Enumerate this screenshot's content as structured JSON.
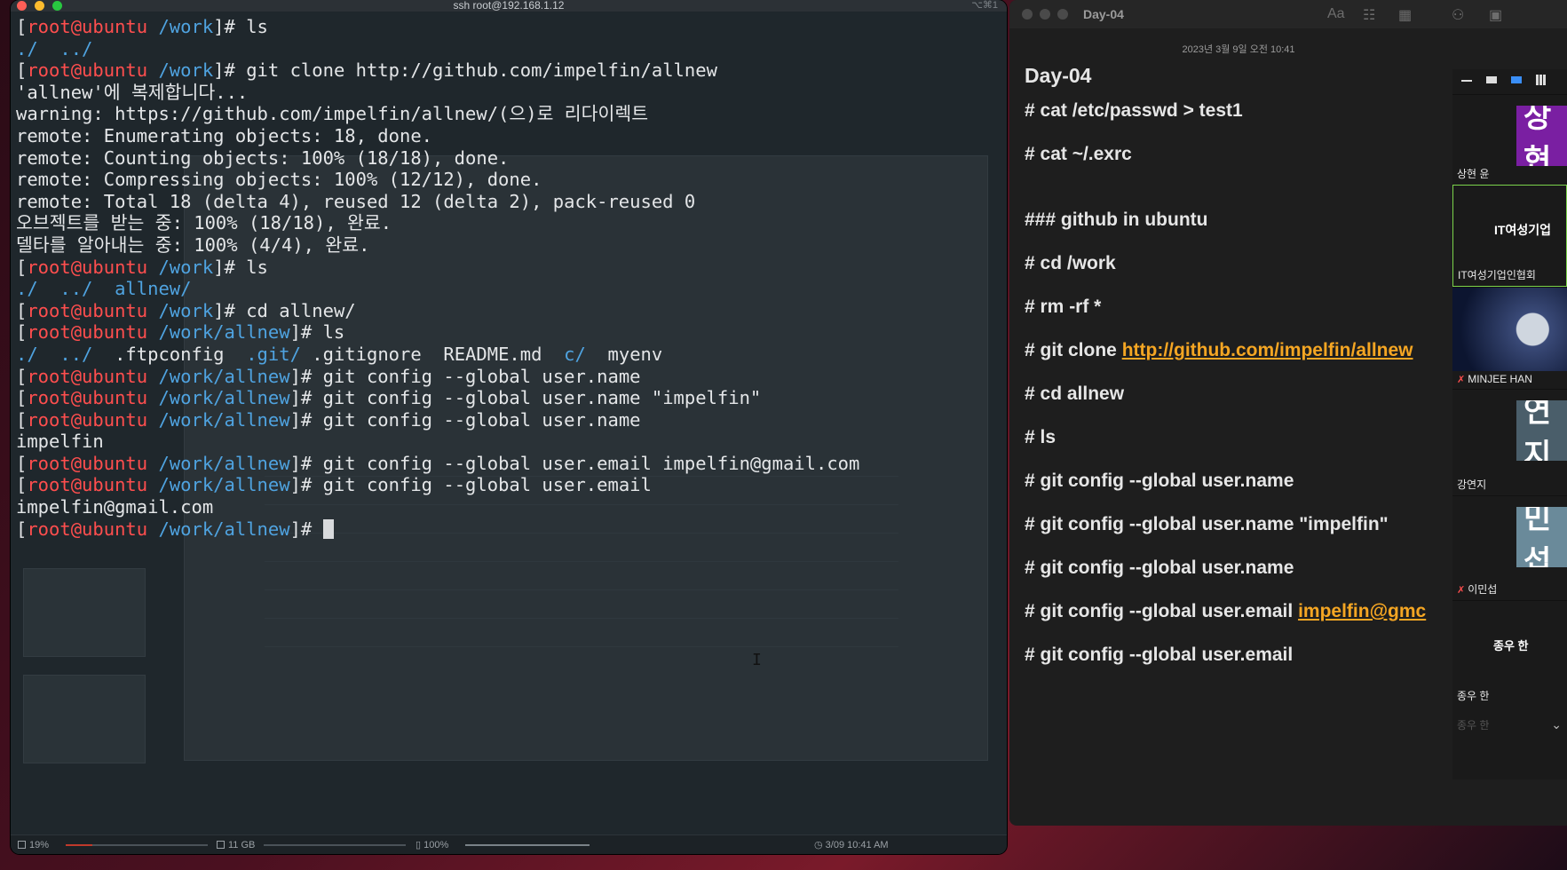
{
  "terminal": {
    "title": "ssh root@192.168.1.12",
    "title_right": "⌥⌘1",
    "prompt": {
      "user": "root",
      "host": "ubuntu"
    },
    "lines": [
      {
        "type": "cmd",
        "path": "/work",
        "cmd": "ls"
      },
      {
        "type": "out",
        "segments": [
          {
            "t": "./  ../",
            "c": "dir"
          }
        ]
      },
      {
        "type": "cmd",
        "path": "/work",
        "cmd": "git clone http://github.com/impelfin/allnew"
      },
      {
        "type": "out",
        "segments": [
          {
            "t": "'allnew'에 복제합니다..."
          }
        ]
      },
      {
        "type": "out",
        "segments": [
          {
            "t": "warning: https://github.com/impelfin/allnew/(으)로 리다이렉트"
          }
        ]
      },
      {
        "type": "out",
        "segments": [
          {
            "t": "remote: Enumerating objects: 18, done."
          }
        ]
      },
      {
        "type": "out",
        "segments": [
          {
            "t": "remote: Counting objects: 100% (18/18), done."
          }
        ]
      },
      {
        "type": "out",
        "segments": [
          {
            "t": "remote: Compressing objects: 100% (12/12), done."
          }
        ]
      },
      {
        "type": "out",
        "segments": [
          {
            "t": "remote: Total 18 (delta 4), reused 12 (delta 2), pack-reused 0"
          }
        ]
      },
      {
        "type": "out",
        "segments": [
          {
            "t": "오브젝트를 받는 중: 100% (18/18), 완료."
          }
        ]
      },
      {
        "type": "out",
        "segments": [
          {
            "t": "델타를 알아내는 중: 100% (4/4), 완료."
          }
        ]
      },
      {
        "type": "cmd",
        "path": "/work",
        "cmd": "ls"
      },
      {
        "type": "out",
        "segments": [
          {
            "t": "./  ../  ",
            "c": "dir"
          },
          {
            "t": "allnew/",
            "c": "dir"
          }
        ]
      },
      {
        "type": "cmd",
        "path": "/work",
        "cmd": "cd allnew/"
      },
      {
        "type": "cmd",
        "path": "/work/allnew",
        "cmd": "ls"
      },
      {
        "type": "out",
        "segments": [
          {
            "t": "./  ../  ",
            "c": "dir"
          },
          {
            "t": ".ftpconfig  "
          },
          {
            "t": ".git/",
            "c": "dir"
          },
          {
            "t": " .gitignore  README.md  "
          },
          {
            "t": "c/",
            "c": "dir"
          },
          {
            "t": "  myenv"
          }
        ]
      },
      {
        "type": "cmd",
        "path": "/work/allnew",
        "cmd": "git config --global user.name"
      },
      {
        "type": "cmd",
        "path": "/work/allnew",
        "cmd": "git config --global user.name \"impelfin\""
      },
      {
        "type": "cmd",
        "path": "/work/allnew",
        "cmd": "git config --global user.name"
      },
      {
        "type": "out",
        "segments": [
          {
            "t": "impelfin"
          }
        ]
      },
      {
        "type": "cmd",
        "path": "/work/allnew",
        "cmd": "git config --global user.email impelfin@gmail.com"
      },
      {
        "type": "cmd",
        "path": "/work/allnew",
        "cmd": "git config --global user.email"
      },
      {
        "type": "out",
        "segments": [
          {
            "t": "impelfin@gmail.com"
          }
        ]
      },
      {
        "type": "cmd",
        "path": "/work/allnew",
        "cmd": "",
        "cursor": true
      }
    ],
    "status": {
      "cpu": "19%",
      "cpu_level": 0.19,
      "mem": "11 GB",
      "battery": "100%",
      "battery_level": 1.0,
      "clock": "3/09 10:41 AM"
    }
  },
  "notes": {
    "window_title": "Day-04",
    "date": "2023년 3월 9일 오전 10:41",
    "heading": "Day-04",
    "lines": [
      {
        "text": "# cat /etc/passwd > test1"
      },
      {
        "text": "# cat ~/.exrc"
      },
      {
        "text": "### github in ubuntu"
      },
      {
        "text": "# cd /work"
      },
      {
        "text": "# rm -rf *"
      },
      {
        "text": "# git clone ",
        "link": "http://github.com/impelfin/allnew"
      },
      {
        "text": "# cd allnew"
      },
      {
        "text": "# ls"
      },
      {
        "text": "# git config --global user.name"
      },
      {
        "text": "# git config --global user.name \"impelfin\""
      },
      {
        "text": "# git config --global user.name"
      },
      {
        "text": "# git config --global user.email ",
        "link": "impelfin@gmc"
      },
      {
        "text": "# git config --global user.email"
      }
    ],
    "toolbar": {
      "font": "Aa",
      "checklist": "☷",
      "table": "▦",
      "share": "⚇",
      "media": "▣"
    }
  },
  "zoom": {
    "participants": [
      {
        "name": "상현 윤",
        "avatar_text": "상현",
        "color": "#7a1fa2"
      },
      {
        "name": "IT여성기업인협회",
        "avatar_text": "IT여성기업",
        "color": ""
      },
      {
        "name": "MINJEE HAN",
        "avatar_text": "",
        "color": ""
      },
      {
        "name": "강연지",
        "avatar_text": "연지",
        "color": "#4a5e6a"
      },
      {
        "name": "이민섭",
        "avatar_text": "민섭",
        "color": "#6a8a9a"
      },
      {
        "name": "종우 한",
        "avatar_text": "종우 한",
        "color": ""
      }
    ],
    "footer": "종우 한"
  }
}
